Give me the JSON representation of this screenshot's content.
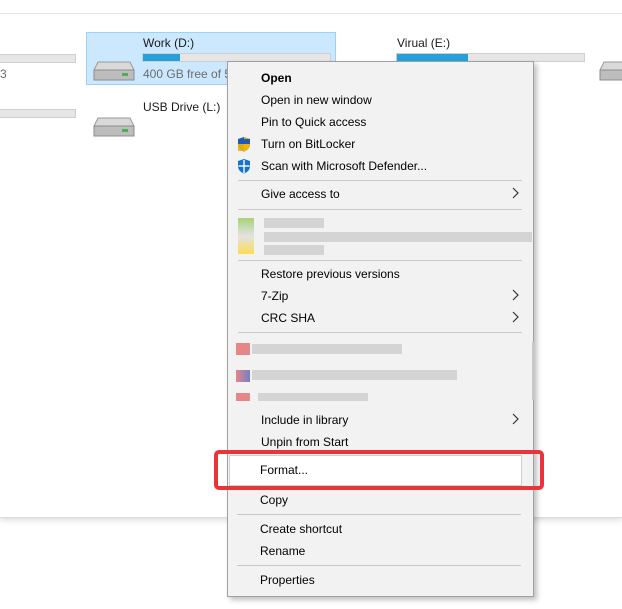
{
  "drives": [
    {
      "name": "",
      "free": "3",
      "fill_pct": 0
    },
    {
      "name": "Work (D:)",
      "free": "400 GB free of 5",
      "fill_pct": 20
    },
    {
      "name": "Virual (E:)",
      "free": "",
      "fill_pct": 38
    },
    {
      "name": "",
      "free": "",
      "fill_pct": 0
    },
    {
      "name": "USB Drive (L:)",
      "free": "",
      "fill_pct": 0
    }
  ],
  "context_menu": {
    "items": {
      "open": "Open",
      "open_new_window": "Open in new window",
      "pin_quick_access": "Pin to Quick access",
      "bitlocker": "Turn on BitLocker",
      "defender": "Scan with Microsoft Defender...",
      "give_access": "Give access to",
      "restore_versions": "Restore previous versions",
      "seven_zip": "7-Zip",
      "crc_sha": "CRC SHA",
      "include_library": "Include in library",
      "unpin_start": "Unpin from Start",
      "format": "Format...",
      "copy": "Copy",
      "create_shortcut": "Create shortcut",
      "rename": "Rename",
      "properties": "Properties"
    }
  },
  "colors": {
    "accent": "#26a0da",
    "selection": "#cce8ff",
    "highlight_border": "#e8353a",
    "menu_bg": "#f2f2f2"
  },
  "icons": {
    "drive": "hard-drive-icon",
    "bitlocker": "shield-icon",
    "defender": "defender-icon",
    "submenu": "chevron-right-icon"
  }
}
